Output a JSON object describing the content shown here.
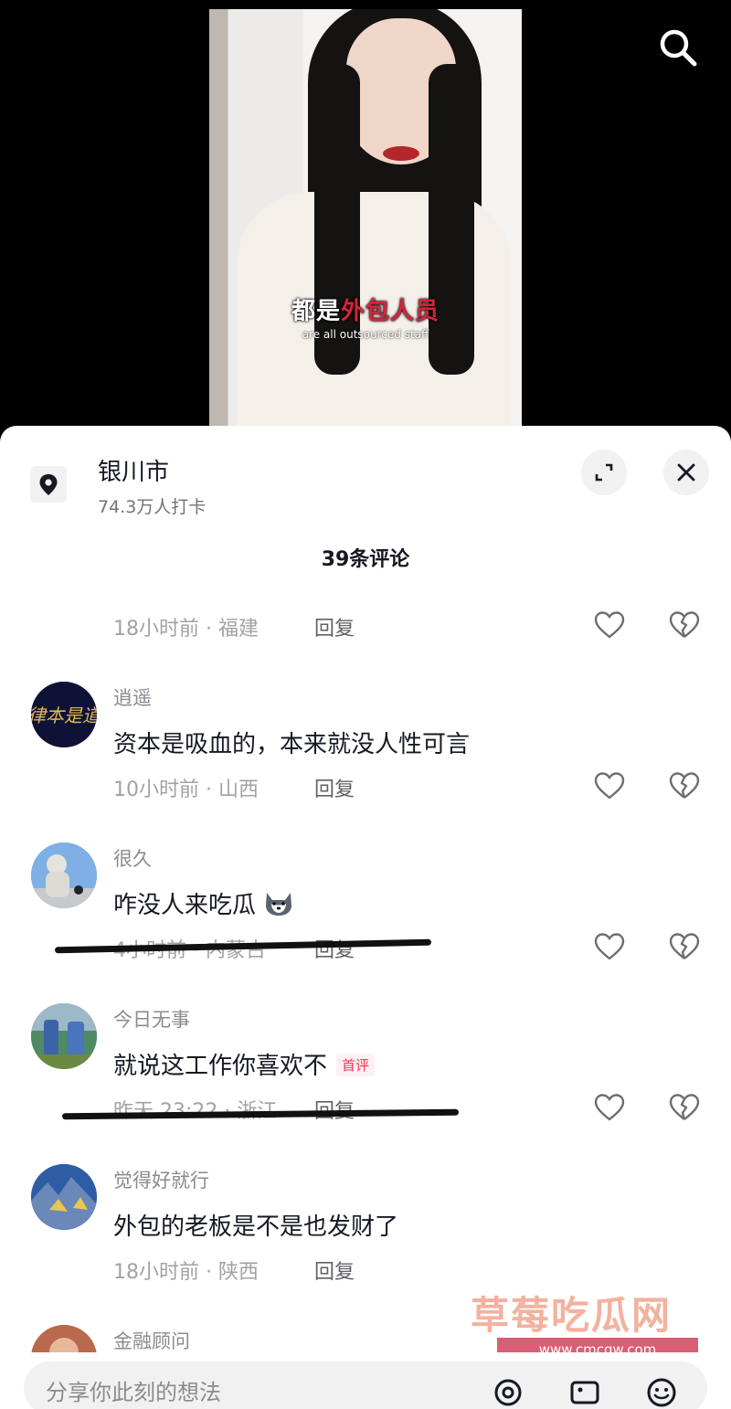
{
  "video": {
    "caption_prefix": "都是",
    "caption_highlight": "外包人员",
    "caption_sub": "are all outsourced staff"
  },
  "location": {
    "title": "银川市",
    "checkins": "74.3万人打卡"
  },
  "comments_count": "39条评论",
  "comments": [
    {
      "name": "",
      "text": "",
      "time_loc": "18小时前 · 福建",
      "reply": "回复",
      "badge": ""
    },
    {
      "name": "逍遥",
      "text": "资本是吸血的，本来就没人性可言",
      "time_loc": "10小时前 · 山西",
      "reply": "回复",
      "badge": ""
    },
    {
      "name": "很久",
      "text": "咋没人来吃瓜",
      "time_loc": "4小时前 · 内蒙古",
      "reply": "回复",
      "badge": ""
    },
    {
      "name": "今日无事",
      "text": "就说这工作你喜欢不",
      "time_loc": "昨天 23:22 · 浙江",
      "reply": "回复",
      "badge": "首评"
    },
    {
      "name": "觉得好就行",
      "text": "外包的老板是不是也发财了",
      "time_loc": "18小时前 · 陕西",
      "reply": "回复",
      "badge": ""
    },
    {
      "name": "金融顾问",
      "text": "",
      "time_loc": "",
      "reply": "",
      "badge": ""
    }
  ],
  "watermark": {
    "text": "草莓吃瓜网",
    "url": "www.cmcgw.com"
  },
  "input": {
    "placeholder": "分享你此刻的想法"
  },
  "colors": {
    "accent": "#fe2c55",
    "panel_bg": "#ffffff",
    "muted": "#a1a2a7"
  }
}
